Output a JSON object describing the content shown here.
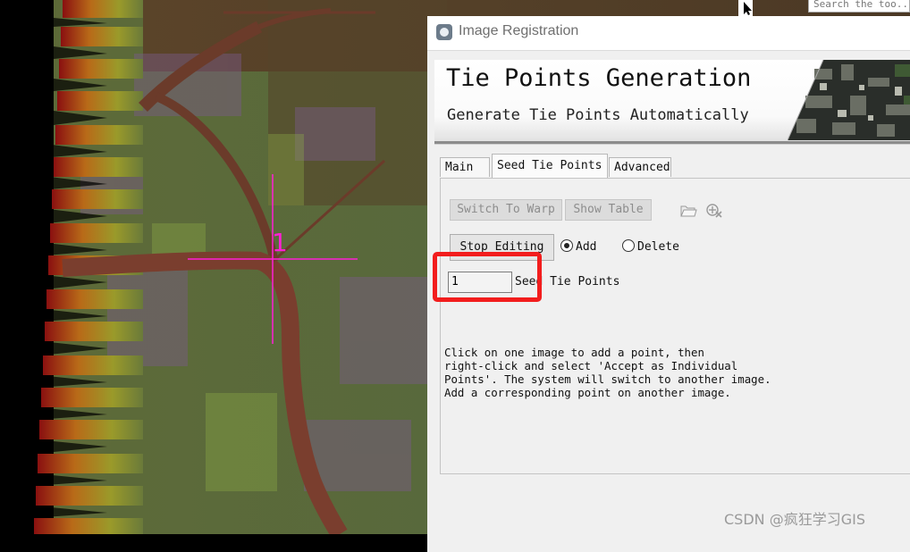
{
  "background": {
    "search_text": "Search the too...",
    "tie_point_label": "1"
  },
  "window": {
    "title": "Image Registration"
  },
  "banner": {
    "title": "Tie Points Generation",
    "subtitle": "Generate Tie Points Automatically"
  },
  "tabs": [
    {
      "label": "Main",
      "active": false
    },
    {
      "label": "Seed Tie Points",
      "active": true
    },
    {
      "label": "Advanced",
      "active": false
    }
  ],
  "seed_panel": {
    "switch_to_warp": "Switch To Warp",
    "show_table": "Show Table",
    "stop_editing": "Stop Editing",
    "radio_add": "Add",
    "radio_delete": "Delete",
    "selected_mode": "Add",
    "count_value": "1",
    "count_label": "Seed Tie Points",
    "help_text": "Click on one image to add a point, then\nright-click and select 'Accept as Individual\nPoints'. The system will switch to another image.\nAdd a corresponding point on another image."
  },
  "watermark": "CSDN @疯狂学习GIS",
  "colors": {
    "highlight": "#f21d1d",
    "crosshair": "#ff1fd6"
  }
}
